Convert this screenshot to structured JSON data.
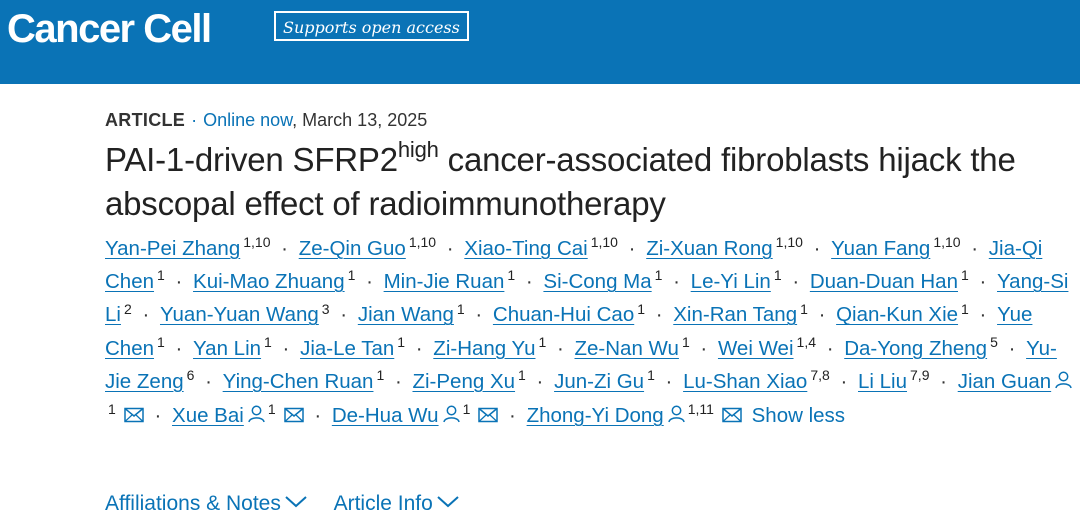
{
  "header": {
    "journal": "Cancer Cell",
    "badge": "Supports open access"
  },
  "article": {
    "type": "ARTICLE",
    "separator": "·",
    "online": "Online now",
    "date": ", March 13, 2025",
    "title_part1": "PAI-1-driven SFRP2",
    "title_sup": "high",
    "title_part2": " cancer-associated fibroblasts hijack the abscopal effect of radioimmunotherapy"
  },
  "authors": [
    {
      "name": "Yan-Pei Zhang",
      "aff": "1,10"
    },
    {
      "name": "Ze-Qin Guo",
      "aff": "1,10"
    },
    {
      "name": "Xiao-Ting Cai",
      "aff": "1,10"
    },
    {
      "name": "Zi-Xuan Rong",
      "aff": "1,10"
    },
    {
      "name": "Yuan Fang",
      "aff": "1,10"
    },
    {
      "name": "Jia-Qi Chen",
      "aff": "1"
    },
    {
      "name": "Kui-Mao Zhuang",
      "aff": "1"
    },
    {
      "name": "Min-Jie Ruan",
      "aff": "1"
    },
    {
      "name": "Si-Cong Ma",
      "aff": "1"
    },
    {
      "name": "Le-Yi Lin",
      "aff": "1"
    },
    {
      "name": "Duan-Duan Han",
      "aff": "1"
    },
    {
      "name": "Yang-Si Li",
      "aff": "2"
    },
    {
      "name": "Yuan-Yuan Wang",
      "aff": "3"
    },
    {
      "name": "Jian Wang",
      "aff": "1"
    },
    {
      "name": "Chuan-Hui Cao",
      "aff": "1"
    },
    {
      "name": "Xin-Ran Tang",
      "aff": "1"
    },
    {
      "name": "Qian-Kun Xie",
      "aff": "1"
    },
    {
      "name": "Yue Chen",
      "aff": "1"
    },
    {
      "name": "Yan Lin",
      "aff": "1"
    },
    {
      "name": "Jia-Le Tan",
      "aff": "1"
    },
    {
      "name": "Zi-Hang Yu",
      "aff": "1"
    },
    {
      "name": "Ze-Nan Wu",
      "aff": "1"
    },
    {
      "name": "Wei Wei",
      "aff": "1,4"
    },
    {
      "name": "Da-Yong Zheng",
      "aff": "5"
    },
    {
      "name": "Yu-Jie Zeng",
      "aff": "6"
    },
    {
      "name": "Ying-Chen Ruan",
      "aff": "1"
    },
    {
      "name": "Zi-Peng Xu",
      "aff": "1"
    },
    {
      "name": "Jun-Zi Gu",
      "aff": "1"
    },
    {
      "name": "Lu-Shan Xiao",
      "aff": "7,8"
    },
    {
      "name": "Li Liu",
      "aff": "7,9"
    },
    {
      "name": "Jian Guan",
      "aff": "1"
    },
    {
      "name": "Xue Bai",
      "aff": "1"
    },
    {
      "name": "De-Hua Wu",
      "aff": "1"
    },
    {
      "name": "Zhong-Yi Dong",
      "aff": "1,11"
    }
  ],
  "show_less": "Show less",
  "links": {
    "affiliations": "Affiliations & Notes",
    "article_info": "Article Info"
  },
  "colors": {
    "brand": "#0a73b6",
    "text": "#222222"
  }
}
